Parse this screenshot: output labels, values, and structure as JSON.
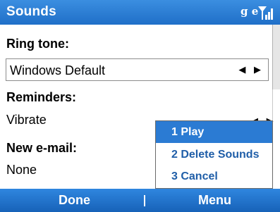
{
  "title_bar": {
    "title": "Sounds",
    "status_text": "g e",
    "signal_icon": "signal-strength-icon"
  },
  "settings": {
    "ring_tone": {
      "label": "Ring tone:",
      "value": "Windows Default"
    },
    "reminders": {
      "label": "Reminders:",
      "value": "Vibrate"
    },
    "new_email": {
      "label": "New e-mail:",
      "value": "None"
    },
    "spinner_arrows": "◀ ▶"
  },
  "context_menu": {
    "items": [
      {
        "label": "1 Play",
        "selected": true
      },
      {
        "label": "2 Delete Sounds",
        "selected": false
      },
      {
        "label": "3 Cancel",
        "selected": false
      }
    ]
  },
  "softkeys": {
    "left": "Done",
    "right": "Menu"
  },
  "colors": {
    "titlebar": "#1f6fc8",
    "selection": "#2b7bd3",
    "menu_text": "#1f5ea8",
    "softkeys": "#1762b8"
  }
}
